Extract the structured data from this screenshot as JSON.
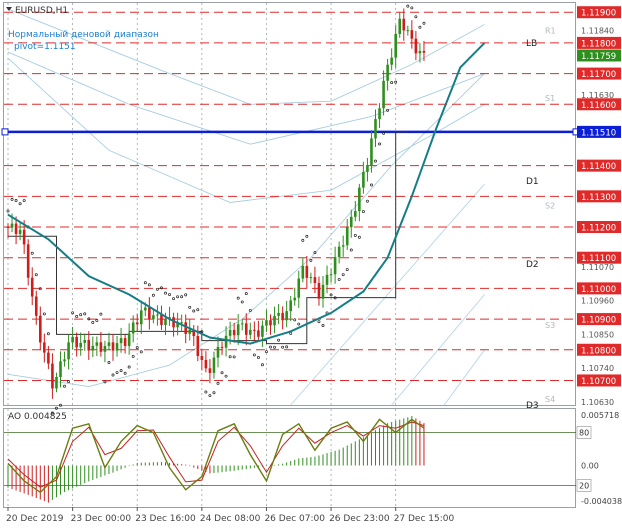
{
  "window": {
    "symbol_title": "EURUSD,H1"
  },
  "indicators": {
    "range_title": "Нормальный деновой диапазон",
    "pivot_text": "pivot=1.1151",
    "ao_label": "AO 0.004825"
  },
  "chart_data": {
    "type": "candlestick",
    "symbol": "EURUSD",
    "timeframe": "H1",
    "price_axis": {
      "range": [
        1.1062,
        1.1193
      ],
      "ticks": [
        {
          "value": 1.119,
          "label": "1.11900",
          "tag": true
        },
        {
          "value": 1.1184,
          "label": "1.11840",
          "tag": false
        },
        {
          "value": 1.118,
          "label": "1.11800",
          "tag": true
        },
        {
          "value": 1.11759,
          "label": "1.11759",
          "tag": true,
          "current": true
        },
        {
          "value": 1.117,
          "label": "1.11700",
          "tag": true
        },
        {
          "value": 1.1163,
          "label": "1.11630",
          "tag": false
        },
        {
          "value": 1.116,
          "label": "1.11600",
          "tag": true
        },
        {
          "value": 1.1151,
          "label": "1.11510",
          "tag": true,
          "pivot": true
        },
        {
          "value": 1.114,
          "label": "1.11400",
          "tag": true
        },
        {
          "value": 1.113,
          "label": "1.11300",
          "tag": true
        },
        {
          "value": 1.112,
          "label": "1.11200",
          "tag": true
        },
        {
          "value": 1.111,
          "label": "1.11100",
          "tag": true
        },
        {
          "value": 1.1107,
          "label": "1.11070",
          "tag": false
        },
        {
          "value": 1.11,
          "label": "1.11000",
          "tag": true
        },
        {
          "value": 1.1096,
          "label": "1.10960",
          "tag": false
        },
        {
          "value": 1.109,
          "label": "1.10900",
          "tag": true
        },
        {
          "value": 1.1085,
          "label": "1.10850",
          "tag": false
        },
        {
          "value": 1.108,
          "label": "1.10800",
          "tag": true
        },
        {
          "value": 1.1074,
          "label": "1.10740",
          "tag": false
        },
        {
          "value": 1.107,
          "label": "1.10700",
          "tag": true
        },
        {
          "value": 1.1063,
          "label": "1.10630",
          "tag": false
        }
      ]
    },
    "red_levels": [
      1.119,
      1.118,
      1.117,
      1.116,
      1.114,
      1.113,
      1.112,
      1.111,
      1.11,
      1.109,
      1.108,
      1.107
    ],
    "pivot_level": 1.1151,
    "level_markers": [
      {
        "label": "R1",
        "value": 1.1184
      },
      {
        "label": "S1",
        "value": 1.1162
      },
      {
        "label": "S2",
        "value": 1.1127
      },
      {
        "label": "S3",
        "value": 1.1088
      },
      {
        "label": "S4",
        "value": 1.1064
      }
    ],
    "line_labels": [
      {
        "label": "LB",
        "value": 1.118
      },
      {
        "label": "D1",
        "value": 1.1135
      },
      {
        "label": "D2",
        "value": 1.1108
      },
      {
        "label": "D3",
        "value": 1.1062
      }
    ],
    "time_axis": [
      {
        "label": "20 Dec 2019",
        "index": 0
      },
      {
        "label": "23 Dec 00:00",
        "index": 16
      },
      {
        "label": "23 Dec 16:00",
        "index": 32
      },
      {
        "label": "24 Dec 08:00",
        "index": 48
      },
      {
        "label": "26 Dec 07:00",
        "index": 64
      },
      {
        "label": "26 Dec 23:00",
        "index": 80
      },
      {
        "label": "27 Dec 15:00",
        "index": 96
      }
    ],
    "bar_count": 104,
    "anchors": [
      [
        0,
        1.112
      ],
      [
        4,
        1.1119
      ],
      [
        8,
        1.1088
      ],
      [
        12,
        1.1068
      ],
      [
        16,
        1.1083
      ],
      [
        22,
        1.1081
      ],
      [
        26,
        1.1081
      ],
      [
        30,
        1.1083
      ],
      [
        34,
        1.1093
      ],
      [
        38,
        1.109
      ],
      [
        42,
        1.1089
      ],
      [
        46,
        1.1086
      ],
      [
        50,
        1.1072
      ],
      [
        54,
        1.1083
      ],
      [
        58,
        1.1088
      ],
      [
        62,
        1.1085
      ],
      [
        66,
        1.109
      ],
      [
        70,
        1.1092
      ],
      [
        74,
        1.1107
      ],
      [
        78,
        1.1098
      ],
      [
        82,
        1.111
      ],
      [
        86,
        1.1123
      ],
      [
        90,
        1.1143
      ],
      [
        94,
        1.1168
      ],
      [
        98,
        1.1188
      ],
      [
        101,
        1.118
      ],
      [
        103,
        1.1176
      ]
    ],
    "ma_line": [
      [
        0,
        1.1124
      ],
      [
        10,
        1.1116
      ],
      [
        20,
        1.1104
      ],
      [
        30,
        1.1098
      ],
      [
        40,
        1.109
      ],
      [
        50,
        1.1084
      ],
      [
        60,
        1.1082
      ],
      [
        70,
        1.1086
      ],
      [
        80,
        1.1092
      ],
      [
        88,
        1.1099
      ],
      [
        94,
        1.111
      ],
      [
        100,
        1.113
      ],
      [
        106,
        1.1152
      ],
      [
        112,
        1.1172
      ],
      [
        118,
        1.118
      ]
    ],
    "channel_lines": [
      [
        [
          0,
          1.1191
        ],
        [
          40,
          1.117
        ],
        [
          60,
          1.116
        ],
        [
          80,
          1.1161
        ],
        [
          100,
          1.1173
        ],
        [
          118,
          1.1186
        ]
      ],
      [
        [
          0,
          1.1177
        ],
        [
          30,
          1.116
        ],
        [
          60,
          1.1147
        ],
        [
          90,
          1.1156
        ],
        [
          118,
          1.117
        ]
      ],
      [
        [
          0,
          1.1175
        ],
        [
          25,
          1.1145
        ],
        [
          55,
          1.1128
        ],
        [
          80,
          1.1132
        ],
        [
          105,
          1.115
        ],
        [
          118,
          1.116
        ]
      ],
      [
        [
          0,
          1.1072
        ],
        [
          20,
          1.1068
        ],
        [
          40,
          1.1075
        ],
        [
          58,
          1.109
        ],
        [
          75,
          1.111
        ],
        [
          95,
          1.114
        ],
        [
          118,
          1.117
        ]
      ]
    ],
    "thin_lines": [
      [
        [
          70,
          1.1062
        ],
        [
          118,
          1.1134
        ]
      ],
      [
        [
          95,
          1.1062
        ],
        [
          118,
          1.1098
        ]
      ],
      [
        [
          108,
          1.1062
        ],
        [
          118,
          1.108
        ]
      ]
    ],
    "step_line": [
      [
        0,
        1.1117
      ],
      [
        12,
        1.1117
      ],
      [
        12,
        1.1085
      ],
      [
        30,
        1.1085
      ],
      [
        30,
        1.1086
      ],
      [
        48,
        1.1086
      ],
      [
        48,
        1.1083
      ],
      [
        64,
        1.1083
      ],
      [
        64,
        1.1082
      ],
      [
        74,
        1.1082
      ],
      [
        74,
        1.1097
      ],
      [
        96,
        1.1097
      ],
      [
        96,
        1.1151
      ],
      [
        99,
        1.1151
      ]
    ],
    "ao": {
      "value_label": "AO 0.004825",
      "range": [
        -0.0047,
        0.0064
      ],
      "ticks": [
        {
          "value": 0.005718,
          "label": "0.005718"
        },
        {
          "value": 0.0,
          "label": "0.00"
        },
        {
          "value": -0.004038,
          "label": "-0.004038"
        }
      ],
      "stoch_levels": [
        {
          "label": "80",
          "value": 80
        },
        {
          "label": "20",
          "value": 20
        }
      ],
      "hist_anchors": [
        [
          0,
          -0.0025
        ],
        [
          6,
          -0.0035
        ],
        [
          10,
          -0.0042
        ],
        [
          14,
          -0.003
        ],
        [
          20,
          -0.0018
        ],
        [
          26,
          -0.0008
        ],
        [
          32,
          0.0003
        ],
        [
          38,
          0.0004
        ],
        [
          44,
          0.0001
        ],
        [
          50,
          -0.0009
        ],
        [
          56,
          -0.0006
        ],
        [
          62,
          -0.0002
        ],
        [
          68,
          0.0002
        ],
        [
          72,
          0.0008
        ],
        [
          76,
          0.001
        ],
        [
          82,
          0.0018
        ],
        [
          88,
          0.0032
        ],
        [
          94,
          0.0048
        ],
        [
          100,
          0.0056
        ],
        [
          103,
          0.0048
        ]
      ],
      "stoch_main": [
        [
          0,
          45
        ],
        [
          4,
          25
        ],
        [
          8,
          12
        ],
        [
          12,
          30
        ],
        [
          16,
          85
        ],
        [
          20,
          90
        ],
        [
          24,
          40
        ],
        [
          28,
          70
        ],
        [
          32,
          88
        ],
        [
          36,
          80
        ],
        [
          40,
          40
        ],
        [
          44,
          15
        ],
        [
          48,
          30
        ],
        [
          52,
          82
        ],
        [
          56,
          90
        ],
        [
          60,
          55
        ],
        [
          64,
          25
        ],
        [
          68,
          78
        ],
        [
          72,
          90
        ],
        [
          76,
          60
        ],
        [
          80,
          85
        ],
        [
          84,
          92
        ],
        [
          88,
          70
        ],
        [
          92,
          95
        ],
        [
          96,
          80
        ],
        [
          100,
          95
        ],
        [
          103,
          85
        ]
      ],
      "stoch_signal": [
        [
          0,
          50
        ],
        [
          4,
          32
        ],
        [
          8,
          18
        ],
        [
          12,
          26
        ],
        [
          16,
          70
        ],
        [
          20,
          86
        ],
        [
          24,
          55
        ],
        [
          28,
          62
        ],
        [
          32,
          82
        ],
        [
          36,
          83
        ],
        [
          40,
          52
        ],
        [
          44,
          24
        ],
        [
          48,
          26
        ],
        [
          52,
          70
        ],
        [
          56,
          86
        ],
        [
          60,
          65
        ],
        [
          64,
          35
        ],
        [
          68,
          65
        ],
        [
          72,
          85
        ],
        [
          76,
          68
        ],
        [
          80,
          80
        ],
        [
          84,
          88
        ],
        [
          88,
          76
        ],
        [
          92,
          88
        ],
        [
          96,
          85
        ],
        [
          100,
          92
        ],
        [
          103,
          88
        ]
      ]
    }
  }
}
